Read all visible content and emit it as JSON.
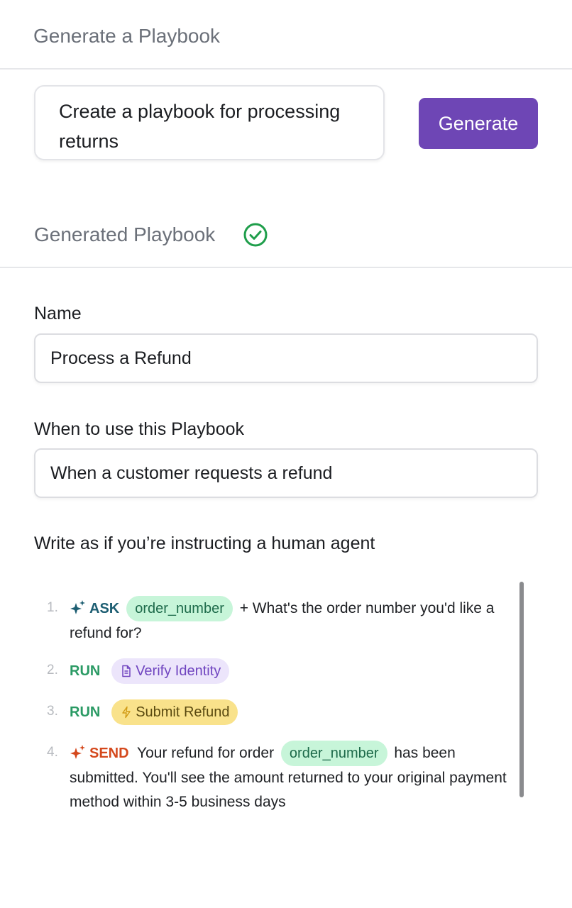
{
  "header": {
    "title": "Generate a Playbook"
  },
  "prompt": {
    "value": "Create a playbook for processing returns"
  },
  "generate_button": {
    "label": "Generate"
  },
  "generated": {
    "title": "Generated Playbook",
    "status_icon": "check-circle-icon",
    "status_color": "#1f9e4b"
  },
  "name_field": {
    "label": "Name",
    "value": "Process a Refund"
  },
  "when_field": {
    "label": "When to use this Playbook",
    "value": "When a customer requests a refund"
  },
  "instructions": {
    "label": "Write as if you’re instructing a human agent",
    "steps": [
      {
        "num": "1.",
        "keyword": "ASK",
        "variable": "order_number",
        "text": "+ What's the order number you'd like a refund for?"
      },
      {
        "num": "2.",
        "keyword": "RUN",
        "pill": "Verify Identity",
        "pill_icon": "document-icon"
      },
      {
        "num": "3.",
        "keyword": "RUN",
        "pill": "Submit Refund",
        "pill_icon": "lightning-icon"
      },
      {
        "num": "4.",
        "keyword": "SEND",
        "text_before": "Your refund for order",
        "variable": "order_number",
        "text_after": "has been submitted. You'll see the amount returned to your original payment method within 3-5 business days"
      }
    ]
  },
  "colors": {
    "accent": "#6e46b5",
    "ask": "#1d5e72",
    "run": "#2a9a64",
    "send": "#d4481c"
  }
}
